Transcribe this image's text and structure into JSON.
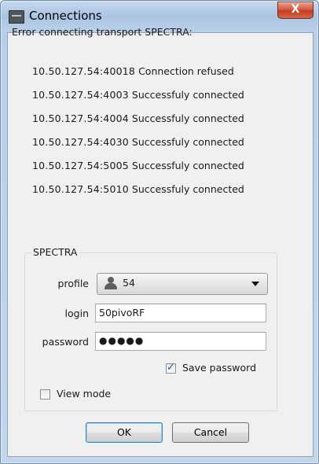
{
  "window": {
    "title": "Connections",
    "close_glyph": "X"
  },
  "error_heading": "Error connecting transport SPECTRA:",
  "connections": [
    {
      "address": "10.50.127.54:40018",
      "status": "Connection refused"
    },
    {
      "address": "10.50.127.54:4003",
      "status": "Successfuly connected"
    },
    {
      "address": "10.50.127.54:4004",
      "status": "Successfuly connected"
    },
    {
      "address": "10.50.127.54:4030",
      "status": "Successfuly connected"
    },
    {
      "address": "10.50.127.54:5005",
      "status": "Successfuly connected"
    },
    {
      "address": "10.50.127.54:5010",
      "status": "Successfuly connected"
    }
  ],
  "group": {
    "title": "SPECTRA",
    "profile_label": "profile",
    "profile_value": "54",
    "profile_icon": "user-icon",
    "login_label": "login",
    "login_value": "50pivoRF",
    "password_label": "password",
    "password_value": "●●●●●",
    "save_password_label": "Save password",
    "save_password_checked": true,
    "view_mode_label": "View mode",
    "view_mode_checked": false
  },
  "buttons": {
    "ok": "OK",
    "cancel": "Cancel"
  }
}
